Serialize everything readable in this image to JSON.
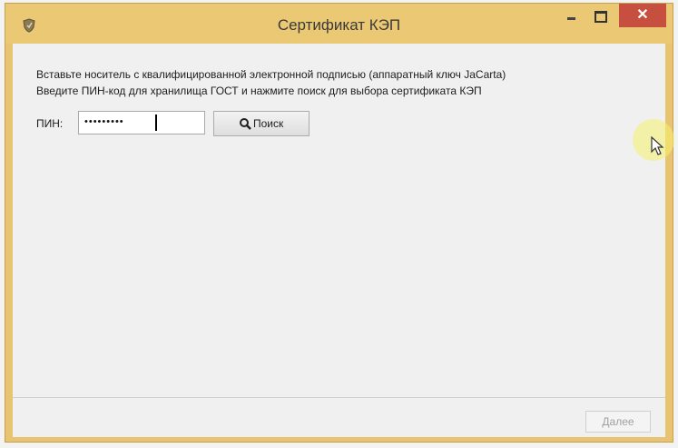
{
  "window": {
    "title": "Сертификат КЭП",
    "close_label": "✕",
    "icon": "shield-icon"
  },
  "instructions": {
    "line1": "Вставьте носитель с квалифицированной электронной подписью (аппаратный ключ JaCarta)",
    "line2": "Введите ПИН-код для хранилища ГОСТ и нажмите поиск для выбора сертификата КЭП"
  },
  "pin": {
    "label": "ПИН:",
    "value": "•••••••••"
  },
  "search_button": {
    "label": "Поиск",
    "icon": "search-icon"
  },
  "footer": {
    "next_label": "Далее"
  },
  "colors": {
    "titlebar": "#ebc873",
    "close_button": "#c74f3f",
    "client_background": "#f0f0f0"
  }
}
